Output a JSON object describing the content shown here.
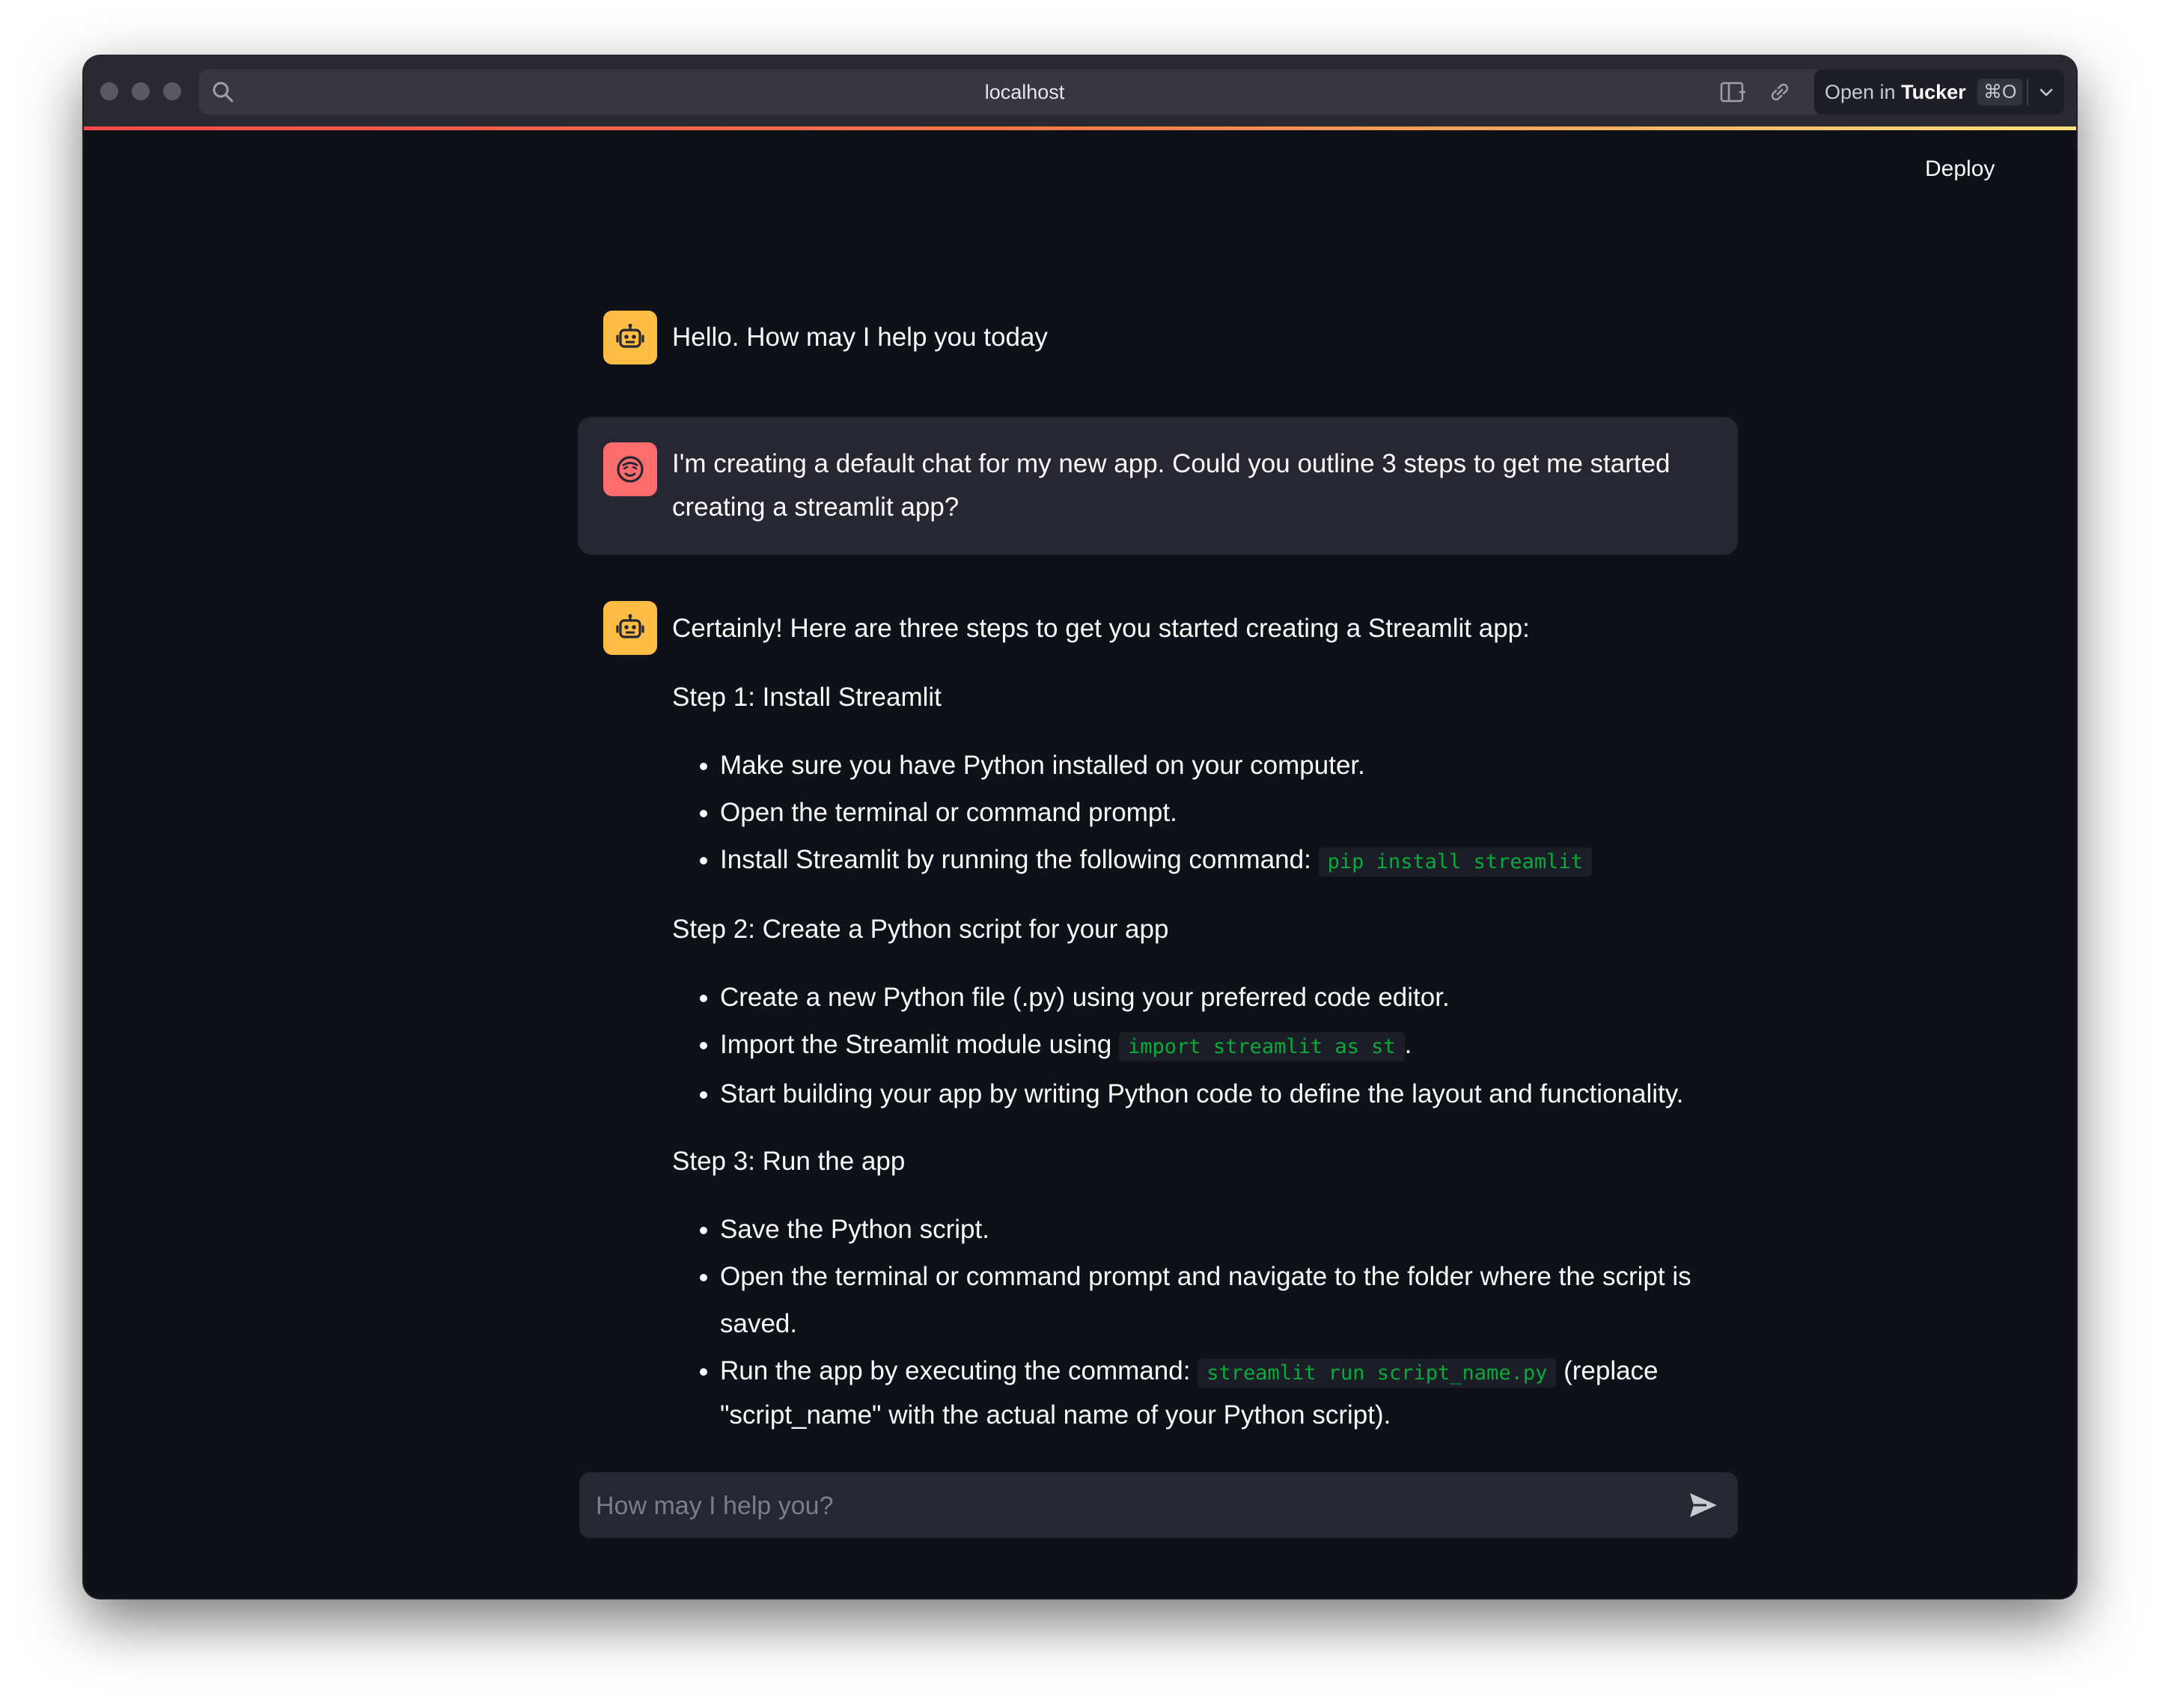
{
  "browser": {
    "url": "localhost",
    "open_in_prefix": "Open in",
    "open_in_app": "Tucker",
    "open_in_shortcut": "⌘O"
  },
  "app": {
    "deploy_label": "Deploy"
  },
  "chat": {
    "messages": [
      {
        "role": "assistant",
        "text": "Hello. How may I help you today"
      },
      {
        "role": "user",
        "text": "I'm creating a default chat for my new app. Could you outline 3 steps to get me started creating a streamlit app?"
      },
      {
        "role": "assistant",
        "intro": "Certainly! Here are three steps to get you started creating a Streamlit app:",
        "step1": {
          "title": "Step 1: Install Streamlit",
          "b1": "Make sure you have Python installed on your computer.",
          "b2": "Open the terminal or command prompt.",
          "b3_text": "Install Streamlit by running the following command:",
          "b3_code": "pip install streamlit"
        },
        "step2": {
          "title": "Step 2: Create a Python script for your app",
          "b1": "Create a new Python file (.py) using your preferred code editor.",
          "b2_text": "Import the Streamlit module using",
          "b2_code": "import streamlit as st",
          "b2_after": ".",
          "b3": "Start building your app by writing Python code to define the layout and functionality."
        },
        "step3": {
          "title": "Step 3: Run the app",
          "b1": "Save the Python script.",
          "b2": "Open the terminal or command prompt and navigate to the folder where the script is saved.",
          "b3_text": "Run the app by executing the command:",
          "b3_code": "streamlit run script_name.py",
          "b3_after": "(replace \"script_name\" with the actual name of your Python script)."
        }
      }
    ],
    "input_placeholder": "How may I help you?"
  },
  "colors": {
    "background": "#0e1117",
    "bot_avatar": "#ffbd45",
    "user_avatar": "#ff6c6c",
    "user_bubble": "#262730",
    "code_text": "#09ab3b"
  },
  "icons": {
    "bot_avatar": "robot-icon",
    "user_avatar": "smiley-face-icon",
    "send": "send-icon",
    "menu": "kebab-menu-icon"
  }
}
